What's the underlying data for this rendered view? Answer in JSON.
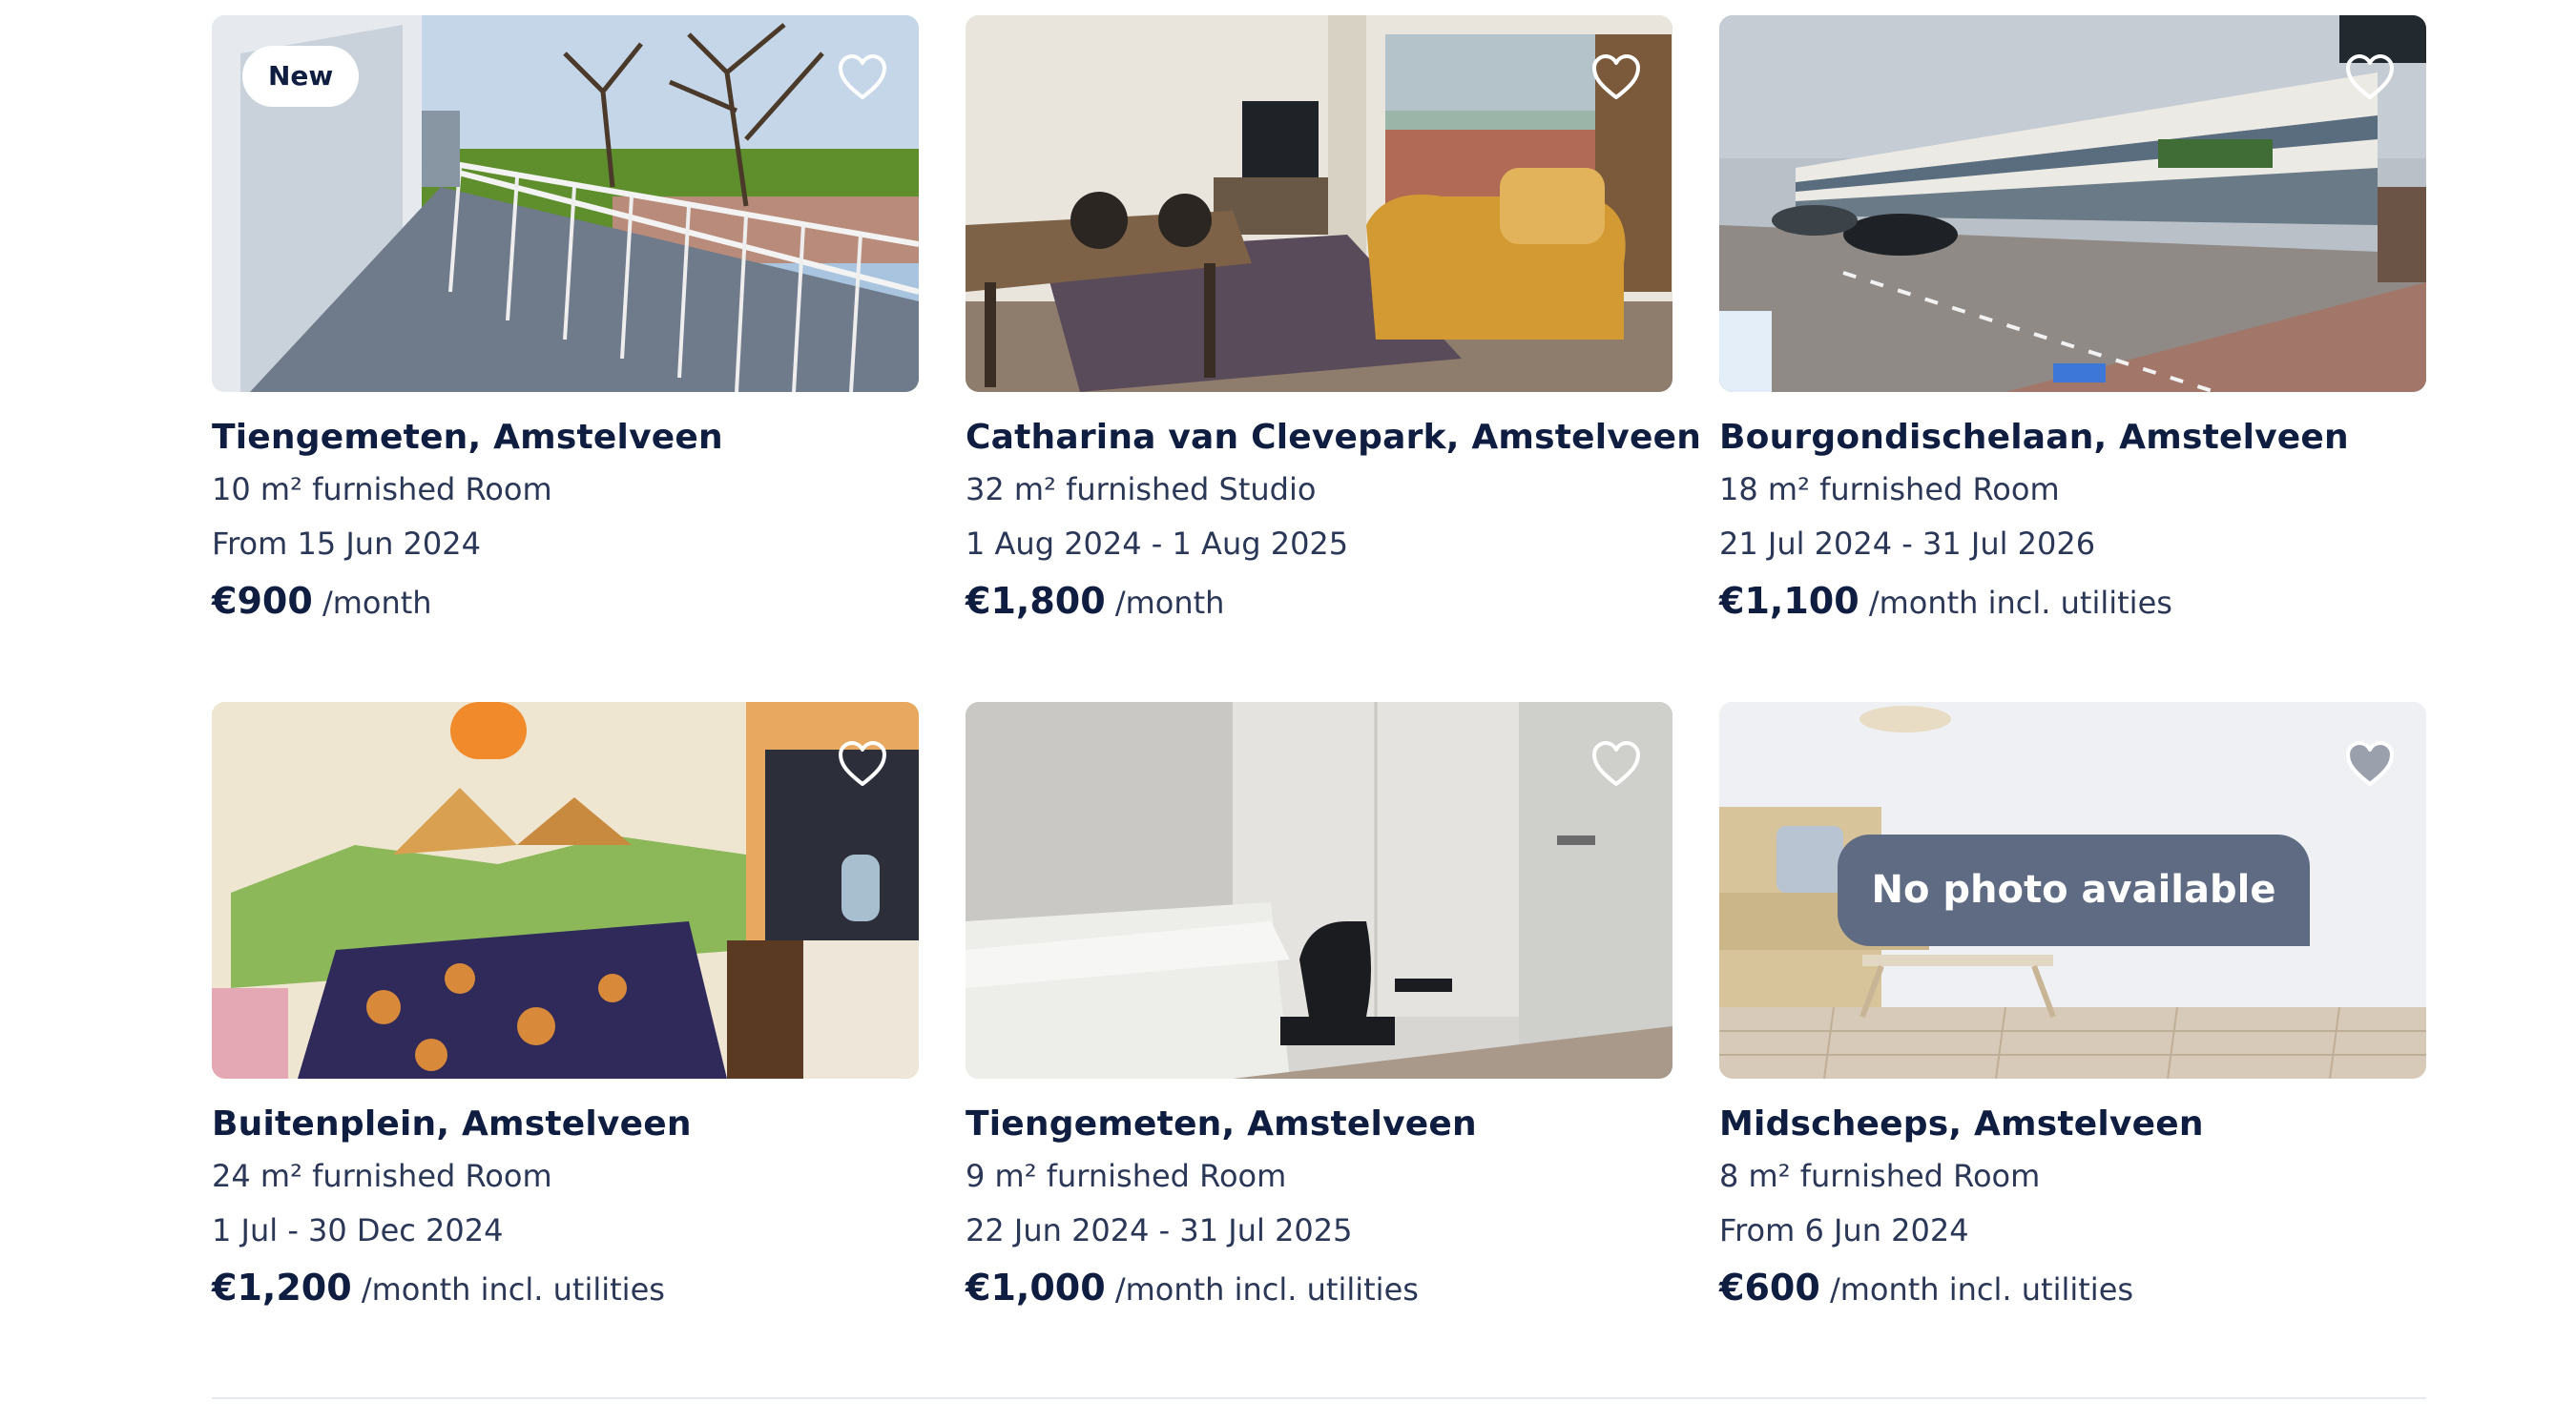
{
  "listings": [
    {
      "badge": "New",
      "title": "Tiengemeten, Amstelveen",
      "details": "10 m² furnished Room",
      "availability": "From 15 Jun 2024",
      "price": "€900",
      "price_suffix": "/month",
      "favorite_icon": "heart-outline-icon"
    },
    {
      "title": "Catharina van Clevepark, Amstelveen",
      "details": "32 m² furnished Studio",
      "availability": "1 Aug 2024 - 1 Aug 2025",
      "price": "€1,800",
      "price_suffix": "/month",
      "favorite_icon": "heart-outline-icon"
    },
    {
      "title": "Bourgondischelaan, Amstelveen",
      "details": "18 m² furnished Room",
      "availability": "21 Jul 2024 - 31 Jul 2026",
      "price": "€1,100",
      "price_suffix": "/month incl. utilities",
      "favorite_icon": "heart-outline-icon"
    },
    {
      "title": "Buitenplein, Amstelveen",
      "details": "24 m² furnished Room",
      "availability": "1 Jul - 30 Dec 2024",
      "price": "€1,200",
      "price_suffix": "/month incl. utilities",
      "favorite_icon": "heart-outline-icon"
    },
    {
      "title": "Tiengemeten, Amstelveen",
      "details": "9 m² furnished Room",
      "availability": "22 Jun 2024 - 31 Jul 2025",
      "price": "€1,000",
      "price_suffix": "/month incl. utilities",
      "favorite_icon": "heart-outline-icon"
    },
    {
      "title": "Midscheeps, Amstelveen",
      "details": "8 m² furnished Room",
      "availability": "From 6 Jun 2024",
      "price": "€600",
      "price_suffix": "/month incl. utilities",
      "placeholder_text": "No photo available",
      "favorite_icon": "heart-outline-icon"
    }
  ],
  "colors": {
    "text_primary": "#0f1d40",
    "text_secondary": "#2b3756",
    "placeholder_banner": "#5e6b83",
    "divider": "#e6e9ef"
  }
}
